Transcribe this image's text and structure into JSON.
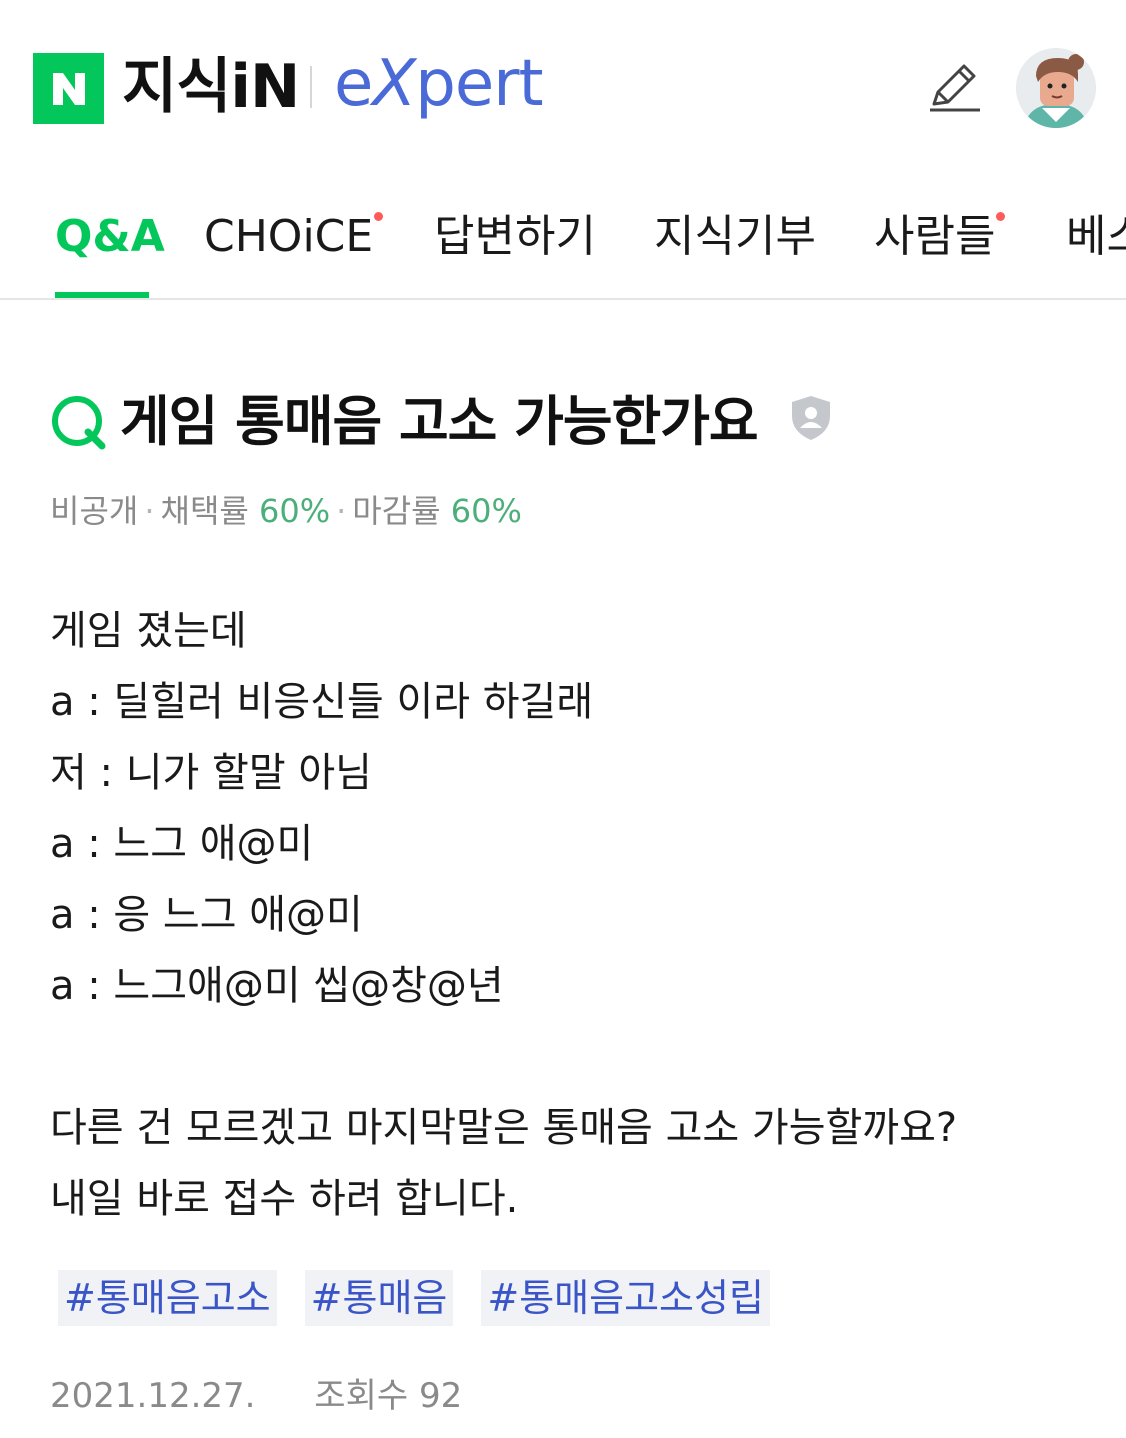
{
  "header": {
    "naver_logo_letter": "N",
    "brand": "지식iN",
    "expert": "eXpert",
    "icons": {
      "write": "pencil-icon",
      "profile": "avatar"
    }
  },
  "tabs": [
    {
      "label": "Q&A",
      "active": true,
      "dot": false
    },
    {
      "label": "CHOiCE",
      "active": false,
      "dot": true
    },
    {
      "label": "답변하기",
      "active": false,
      "dot": false
    },
    {
      "label": "지식기부",
      "active": false,
      "dot": false
    },
    {
      "label": "사람들",
      "active": false,
      "dot": true
    },
    {
      "label": "베스",
      "active": false,
      "dot": false
    }
  ],
  "question": {
    "title": "게임 통매음 고소 가능한가요",
    "meta": {
      "visibility": "비공개",
      "adoption_label": "채택률",
      "adoption_value": "60%",
      "closing_label": "마감률",
      "closing_value": "60%"
    },
    "body_lines": [
      "게임 졌는데",
      "a : 딜힐러 비응신들 이라 하길래",
      "저 : 니가 할말 아님",
      "a : 느그 애@미",
      "a : 응 느그 애@미",
      "a : 느그애@미 씹@창@년",
      "",
      "다른 건 모르겠고 마지막말은 통매음 고소 가능할까요?",
      "내일 바로 접수 하려 합니다."
    ],
    "tags": [
      "#통매음고소",
      "#통매음",
      "#통매음고소성립"
    ],
    "date": "2021.12.27.",
    "views_label": "조회수",
    "views": "92"
  },
  "colors": {
    "naver_green": "#03c75a",
    "expert_blue": "#4a6ad8",
    "tag_text": "#3a55c8",
    "percent_green": "#4caf7a",
    "notification_dot": "#ff5a5a"
  }
}
